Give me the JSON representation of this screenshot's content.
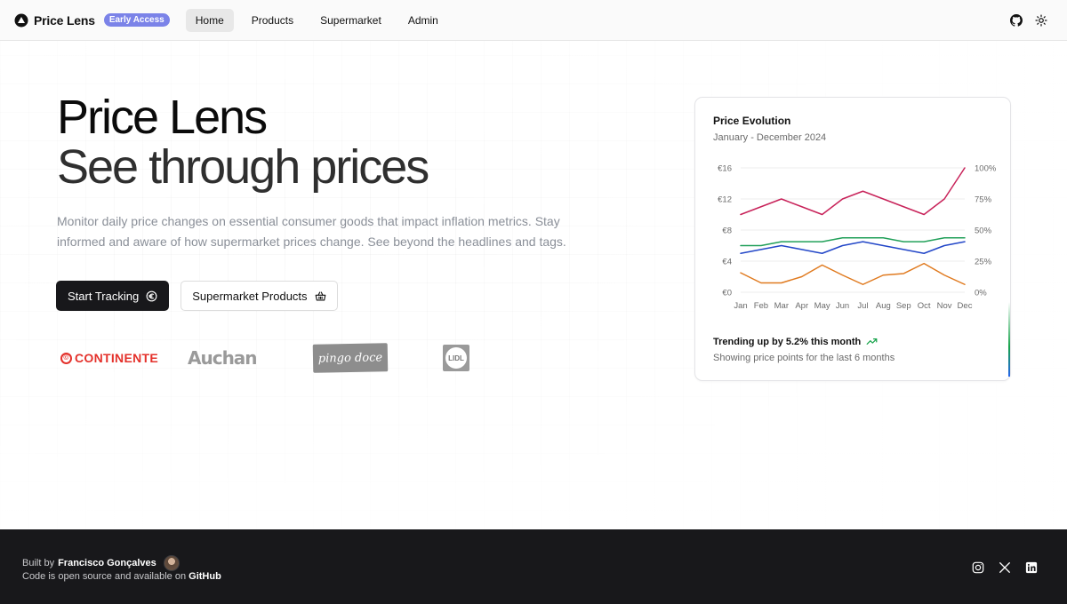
{
  "header": {
    "brand": "Price Lens",
    "badge": "Early Access",
    "nav": [
      "Home",
      "Products",
      "Supermarket",
      "Admin"
    ],
    "icons": [
      "github-icon",
      "sun-icon"
    ]
  },
  "hero": {
    "title_line1": "Price Lens",
    "title_line2": "See through prices",
    "description": "Monitor daily price changes on essential consumer goods that impact inflation metrics. Stay informed and aware of how supermarket prices change. See beyond the headlines and tags.",
    "cta_primary": "Start Tracking",
    "cta_primary_icon": "euro-icon",
    "cta_secondary": "Supermarket Products",
    "cta_secondary_icon": "basket-icon"
  },
  "logos": {
    "continente": "CONTINENTE",
    "auchan": "Auchan",
    "pingo_doce": "pingo doce",
    "lidl": "LIDL"
  },
  "card": {
    "title": "Price Evolution",
    "subtitle": "January - December 2024",
    "trend_text": "Trending up by 5.2% this month",
    "trend_icon": "trending-up-icon",
    "footer_text": "Showing price points for the last 6 months"
  },
  "chart_data": {
    "type": "line",
    "categories": [
      "Jan",
      "Feb",
      "Mar",
      "Apr",
      "May",
      "Jun",
      "Jul",
      "Aug",
      "Sep",
      "Oct",
      "Nov",
      "Dec"
    ],
    "y_left_ticks": [
      "€16",
      "€12",
      "€8",
      "€4",
      "€0"
    ],
    "y_right_ticks": [
      "100%",
      "75%",
      "50%",
      "25%",
      "0%"
    ],
    "ylim": [
      0,
      16
    ],
    "grid": true,
    "series": [
      {
        "color": "#c8235a",
        "values": [
          10,
          11,
          12,
          11,
          10,
          12,
          13,
          12,
          11,
          10,
          12,
          16
        ]
      },
      {
        "color": "#22a05a",
        "values": [
          6,
          6,
          6.5,
          6.5,
          6.5,
          7,
          7,
          7,
          6.5,
          6.5,
          7,
          7
        ]
      },
      {
        "color": "#2347c8",
        "values": [
          5,
          5.5,
          6,
          5.5,
          5,
          6,
          6.5,
          6,
          5.5,
          5,
          6,
          6.5
        ]
      },
      {
        "color": "#e07a1f",
        "values": [
          2.5,
          1.2,
          1.2,
          2,
          3.5,
          2.2,
          1,
          2.2,
          2.4,
          3.7,
          2.2,
          1
        ]
      }
    ]
  },
  "footer": {
    "built_by_prefix": "Built by",
    "author": "Francisco Gonçalves",
    "line2_prefix": "Code is open source and available on",
    "github_link": "GitHub",
    "social": [
      "instagram-icon",
      "x-icon",
      "linkedin-icon"
    ]
  }
}
